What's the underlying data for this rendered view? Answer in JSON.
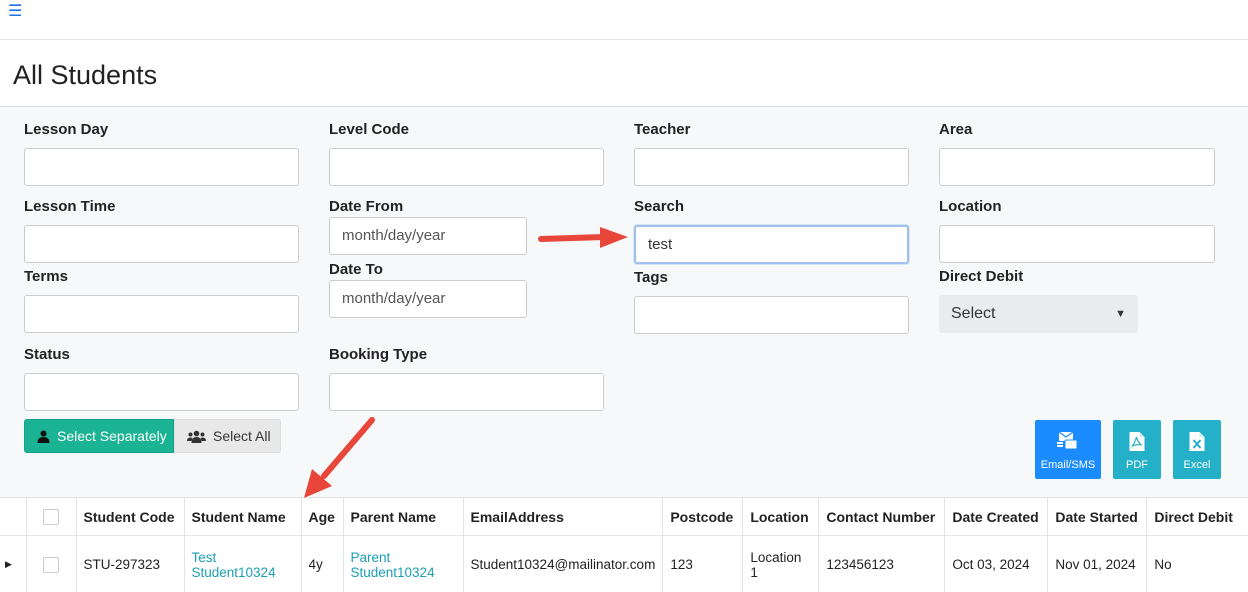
{
  "topbar": {
    "menu_icon": "hamburger-icon"
  },
  "page": {
    "title": "All Students"
  },
  "filters": {
    "lesson_day": {
      "label": "Lesson Day",
      "value": ""
    },
    "level_code": {
      "label": "Level Code",
      "value": ""
    },
    "teacher": {
      "label": "Teacher",
      "value": ""
    },
    "area": {
      "label": "Area",
      "value": ""
    },
    "lesson_time": {
      "label": "Lesson Time",
      "value": ""
    },
    "date_from": {
      "label": "Date From",
      "placeholder": "month/day/year"
    },
    "search": {
      "label": "Search",
      "value": "test"
    },
    "location": {
      "label": "Location",
      "value": ""
    },
    "terms": {
      "label": "Terms",
      "value": ""
    },
    "date_to": {
      "label": "Date To",
      "placeholder": "month/day/year"
    },
    "tags": {
      "label": "Tags",
      "value": ""
    },
    "direct_debit": {
      "label": "Direct Debit",
      "selected": "Select"
    },
    "status": {
      "label": "Status",
      "value": ""
    },
    "booking_type": {
      "label": "Booking Type",
      "value": ""
    }
  },
  "selection": {
    "separately_label": "Select Separately",
    "all_label": "Select All"
  },
  "export": {
    "email_sms": {
      "label": "Email/SMS",
      "icon": "email-sms-icon",
      "color": "#1a8cff"
    },
    "pdf": {
      "label": "PDF",
      "icon": "pdf-icon",
      "color": "#23b0c8"
    },
    "excel": {
      "label": "Excel",
      "icon": "excel-icon",
      "color": "#23b0c8"
    }
  },
  "table": {
    "columns": [
      "Student Code",
      "Student Name",
      "Age",
      "Parent Name",
      "EmailAddress",
      "Postcode",
      "Location",
      "Contact Number",
      "Date Created",
      "Date Started",
      "Direct Debit"
    ],
    "rows": [
      {
        "student_code": "STU-297323",
        "student_name_1": "Test",
        "student_name_2": "Student10324",
        "age": "4y",
        "parent_name_1": "Parent",
        "parent_name_2": "Student10324",
        "email": "Student10324@mailinator.com",
        "postcode": "123",
        "location_1": "Location",
        "location_2": "1",
        "contact": "123456123",
        "date_created": "Oct 03, 2024",
        "date_started": "Nov 01, 2024",
        "direct_debit": "No"
      }
    ]
  },
  "colors": {
    "accent_green": "#1ab394",
    "link": "#1a9fb5",
    "annotation_arrow": "#e8463a"
  }
}
